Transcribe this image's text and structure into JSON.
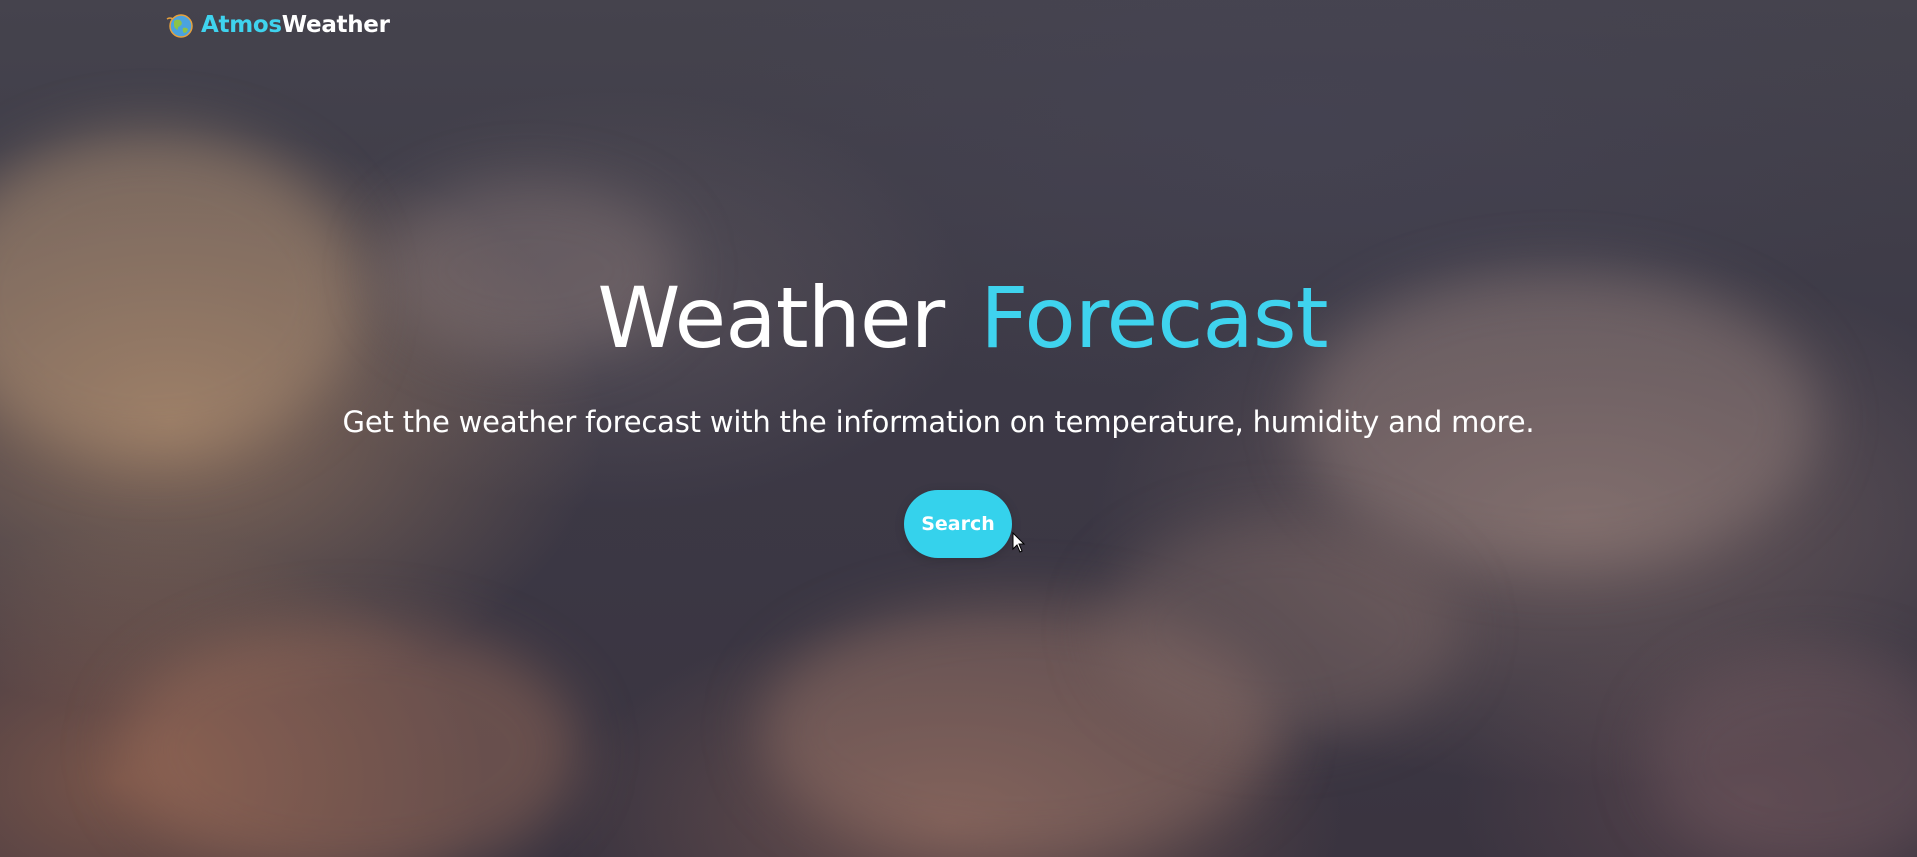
{
  "brand": {
    "name_part1": "Atmos",
    "name_part2": "Weather",
    "logo_icon": "globe-icon"
  },
  "hero": {
    "title_part1": "Weather",
    "title_part2": "Forecast",
    "subtitle": "Get the weather forecast with the information on temperature, humidity and more.",
    "search_button_label": "Search"
  },
  "colors": {
    "accent": "#35d2ec",
    "text": "#ffffff",
    "background": "#3c3946"
  }
}
